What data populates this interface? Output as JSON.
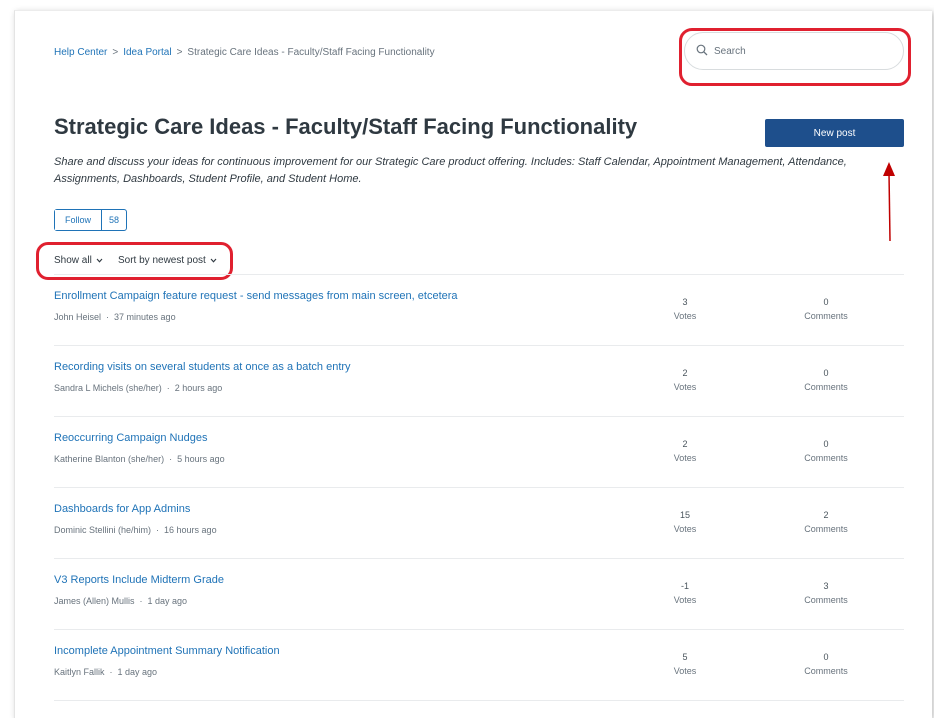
{
  "breadcrumb": [
    "Help Center",
    "Idea Portal",
    "Strategic Care Ideas - Faculty/Staff Facing Functionality"
  ],
  "breadcrumb_separator": ">",
  "search": {
    "placeholder": "Search",
    "icon": "search-icon"
  },
  "page_title": "Strategic Care Ideas - Faculty/Staff Facing Functionality",
  "new_post_label": "New post",
  "description": "Share and discuss your ideas for continuous improvement for our Strategic Care product offering. Includes: Staff Calendar, Appointment Management, Attendance, Assignments, Dashboards, Student Profile, and Student Home.",
  "follow": {
    "label": "Follow",
    "count": "58"
  },
  "filters": {
    "show": "Show all",
    "sort": "Sort by newest post"
  },
  "posts": [
    {
      "title": "Enrollment Campaign feature request - send messages from main screen, etcetera",
      "author": "John Heisel",
      "time": "37 minutes ago",
      "votes": "3",
      "comments": "0"
    },
    {
      "title": "Recording visits on several students at once as a batch entry",
      "author": "Sandra L Michels (she/her)",
      "time": "2 hours ago",
      "votes": "2",
      "comments": "0"
    },
    {
      "title": "Reoccurring Campaign Nudges",
      "author": "Katherine Blanton (she/her)",
      "time": "5 hours ago",
      "votes": "2",
      "comments": "0"
    },
    {
      "title": "Dashboards for App Admins",
      "author": "Dominic Stellini (he/him)",
      "time": "16 hours ago",
      "votes": "15",
      "comments": "2"
    },
    {
      "title": "V3 Reports Include Midterm Grade",
      "author": "James (Allen) Mullis",
      "time": "1 day ago",
      "votes": "-1",
      "comments": "3"
    },
    {
      "title": "Incomplete Appointment Summary Notification",
      "author": "Kaitlyn Fallik",
      "time": "1 day ago",
      "votes": "5",
      "comments": "0"
    }
  ],
  "labels": {
    "votes": "Votes",
    "comments": "Comments",
    "meta_dot": "·"
  },
  "colors": {
    "link": "#1f73b7",
    "primary_button": "#1e4f8c",
    "highlight": "#e0202f",
    "annotation_arrow": "#c00000"
  }
}
